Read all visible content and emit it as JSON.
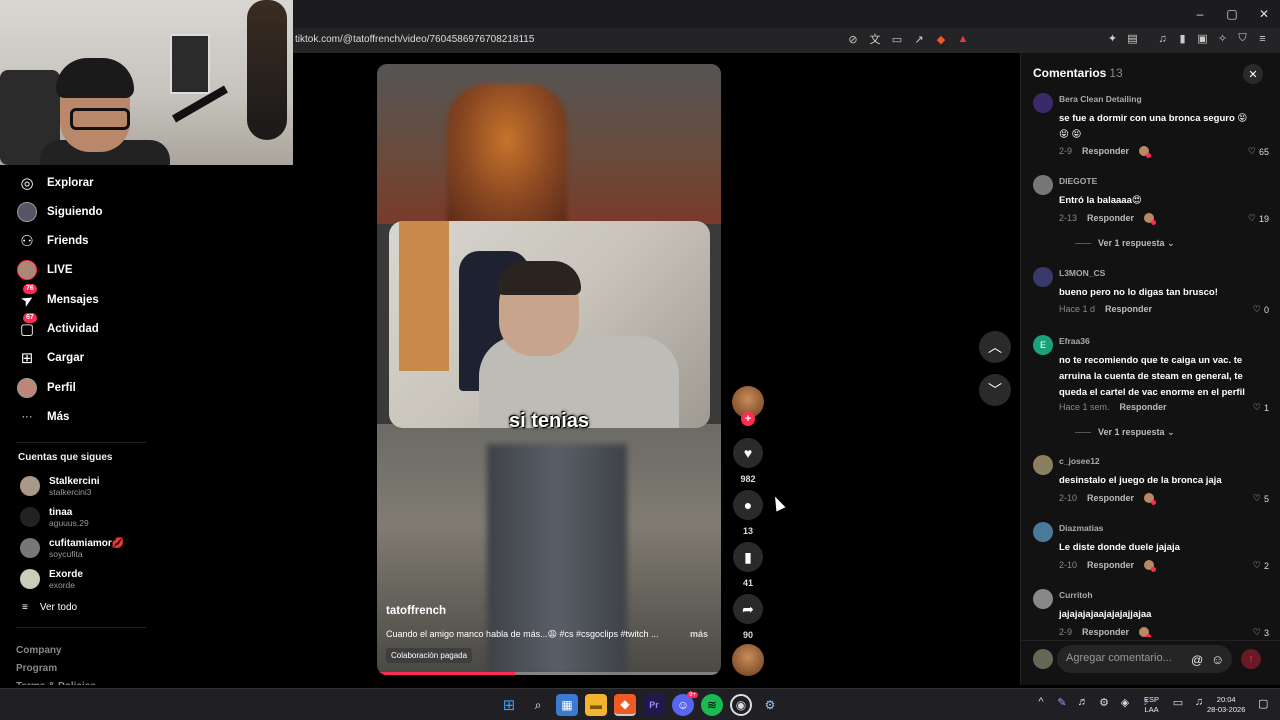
{
  "browser": {
    "url": "tiktok.com/@tatoffrench/video/7604586976708218115",
    "window_controls": [
      "–",
      "▢",
      "✕"
    ]
  },
  "sidebar": {
    "items": [
      {
        "label": "Explorar",
        "icon": "compass-icon",
        "glyph": "◎",
        "badge": ""
      },
      {
        "label": "Siguiendo",
        "icon": "following-avatar-icon",
        "glyph": "",
        "badge": ""
      },
      {
        "label": "Friends",
        "icon": "friends-icon",
        "glyph": "⚇",
        "badge": ""
      },
      {
        "label": "LIVE",
        "icon": "live-avatar-icon",
        "glyph": "",
        "badge": ""
      },
      {
        "label": "Mensajes",
        "icon": "send-icon",
        "glyph": "➤",
        "badge": "76"
      },
      {
        "label": "Actividad",
        "icon": "activity-icon",
        "glyph": "▢",
        "badge": "67"
      },
      {
        "label": "Cargar",
        "icon": "upload-icon",
        "glyph": "⊞",
        "badge": ""
      },
      {
        "label": "Perfil",
        "icon": "profile-avatar-icon",
        "glyph": "",
        "badge": ""
      },
      {
        "label": "Más",
        "icon": "more-icon",
        "glyph": "···",
        "badge": ""
      }
    ],
    "following_title": "Cuentas que sigues",
    "following": [
      {
        "name": "Stalkercini",
        "handle": "stalkercini3"
      },
      {
        "name": "tinaa",
        "handle": "aguuus.29"
      },
      {
        "name": "cufitamiamor💋",
        "handle": "soycufita"
      },
      {
        "name": "Exorde",
        "handle": "exorde"
      }
    ],
    "see_all": "Ver todo",
    "footer": [
      "Company",
      "Program",
      "Terms & Policies"
    ]
  },
  "video": {
    "caption_text": "si tenias",
    "username": "tatoffrench",
    "description": "Cuando el amigo manco habla de más...😩 #cs #csgoclips #twitch ...",
    "more": "más",
    "collab_badge": "Colaboración pagada",
    "progress_fraction": 0.4
  },
  "actions": {
    "likes": "982",
    "comments": "13",
    "saves": "41",
    "shares": "90"
  },
  "comments": {
    "title": "Comentarios",
    "count": "13",
    "list": [
      {
        "user": "Bera Clean Detailing",
        "text": "se fue a dormir con una bronca seguro 😝 😝 😝",
        "date": "2-9",
        "likes": "65",
        "replies": ""
      },
      {
        "user": "DIEGOTE",
        "text": "Entró la balaaaa😍",
        "date": "2-13",
        "likes": "19",
        "replies": "Ver 1 respuesta"
      },
      {
        "user": "L3MON_CS",
        "text": "bueno pero no lo digas tan brusco!",
        "date": "Hace 1 d",
        "likes": "0",
        "replies": ""
      },
      {
        "user": "Efraa36",
        "text": "no te recomiendo que te caiga un vac. te arruina la cuenta de steam en general, te queda el cartel de vac enorme en el perfil",
        "date": "Hace 1 sem.",
        "likes": "1",
        "replies": "Ver 1 respuesta"
      },
      {
        "user": "c_josee12",
        "text": "desinstalo el juego de la bronca jaja",
        "date": "2-10",
        "likes": "5",
        "replies": ""
      },
      {
        "user": "Diazmatias",
        "text": "Le diste donde duele jajaja",
        "date": "2-10",
        "likes": "2",
        "replies": ""
      },
      {
        "user": "Curritoh",
        "text": "jajajajajaajajajajjajaa",
        "date": "2-9",
        "likes": "3",
        "replies": ""
      }
    ],
    "reply_label": "Responder",
    "input_placeholder": "Agregar comentario...",
    "efraa_initial": "E"
  },
  "taskbar": {
    "lang_top": "ESP",
    "lang_bottom": "LAA",
    "time": "20:04",
    "date": "28-03-2026",
    "discord_badge": "9+"
  },
  "colors": {
    "accent": "#fe2c55",
    "panel": "#121212"
  }
}
